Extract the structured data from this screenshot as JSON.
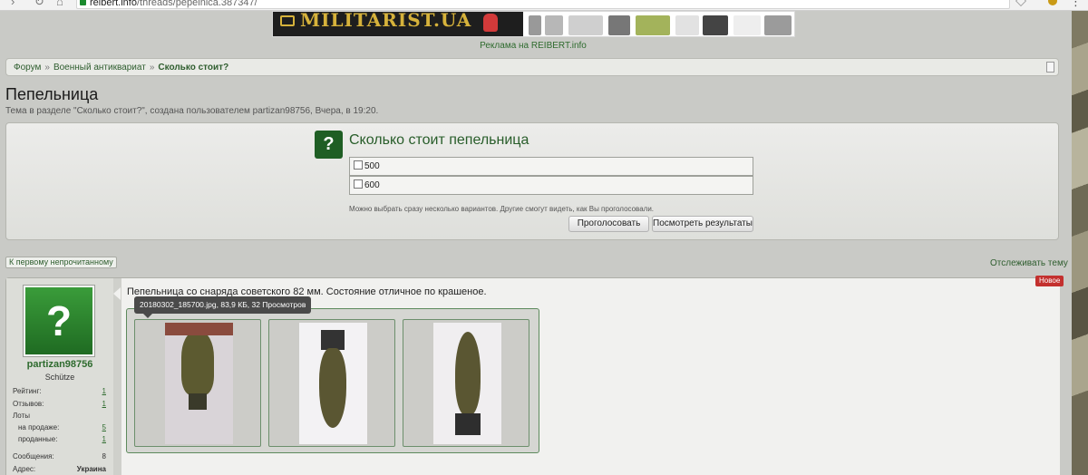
{
  "browser": {
    "url_domain": "reibert.info",
    "url_path": "/threads/pepelnica.387347/"
  },
  "banner": {
    "logo_text": "MILITARIST.UA",
    "ad_label": "Реклама на REIBERT.info"
  },
  "breadcrumb": {
    "items": [
      "Форум",
      "Военный антиквариат",
      "Сколько стоит?"
    ],
    "separator": "»"
  },
  "thread": {
    "title": "Пепельница",
    "description": "Тема в разделе \"Сколько стоит?\", создана пользователем partizan98756, Вчера, в 19:20."
  },
  "poll": {
    "question": "Сколько стоит пепельница",
    "options": [
      {
        "label": "500",
        "checked": false
      },
      {
        "label": "600",
        "checked": false
      }
    ],
    "note": "Можно выбрать сразу несколько вариантов. Другие смогут видеть, как Вы проголосовали.",
    "vote_label": "Проголосовать",
    "results_label": "Посмотреть результаты"
  },
  "controls": {
    "first_unread": "К первому непрочитанному",
    "watch_thread": "Отслеживать тему"
  },
  "user": {
    "avatar_glyph": "?",
    "name": "partizan98756",
    "rank": "Schütze",
    "stats": [
      {
        "label": "Рейтинг:",
        "value": "1"
      },
      {
        "label": "Отзывов:",
        "value": "1"
      },
      {
        "label": "Лоты",
        "value": ""
      },
      {
        "label": "на продаже:",
        "value": "5"
      },
      {
        "label": "проданные:",
        "value": "1"
      },
      {
        "label": "Сообщения:",
        "value": "8"
      },
      {
        "label": "Адрес:",
        "value": "Украина"
      }
    ]
  },
  "post": {
    "text": "Пепельница со снаряда советского 82 мм. Состояние отличное по крашеное.",
    "badge": "Новое",
    "tooltip": "20180302_185700.jpg, 83,9 КБ, 32 Просмотров",
    "attachments": [
      "thumb-1",
      "thumb-2",
      "thumb-3"
    ]
  },
  "colors": {
    "brand_green": "#2e6b2e",
    "badge_red": "#c3302e",
    "poll_icon": "#1f5e24"
  }
}
